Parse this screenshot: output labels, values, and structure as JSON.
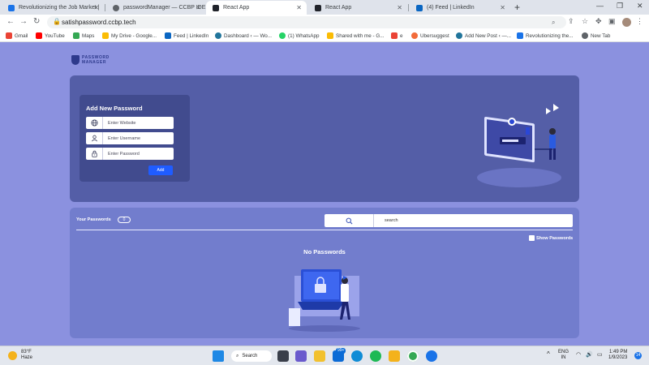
{
  "browser": {
    "tabs": [
      {
        "title": "Revolutionizing the Job Market |",
        "color": "#1a73e8"
      },
      {
        "title": "passwordManager — CCBP IDE",
        "color": "#5f6368"
      },
      {
        "title": "React App",
        "color": "#20232a"
      },
      {
        "title": "React App",
        "color": "#20232a"
      },
      {
        "title": "(4) Feed | LinkedIn",
        "color": "#0a66c2"
      }
    ],
    "url": "satishpassword.ccbp.tech",
    "bookmarks": [
      {
        "label": "Gmail",
        "color": "#ea4335"
      },
      {
        "label": "YouTube",
        "color": "#ff0000"
      },
      {
        "label": "Maps",
        "color": "#34a853"
      },
      {
        "label": "My Drive - Google...",
        "color": "#fbbc04"
      },
      {
        "label": "Feed | LinkedIn",
        "color": "#0a66c2"
      },
      {
        "label": "Dashboard ‹ — Wo...",
        "color": "#21759b"
      },
      {
        "label": "(1) WhatsApp",
        "color": "#25d366"
      },
      {
        "label": "Shared with me - G...",
        "color": "#fbbc04"
      },
      {
        "label": "e",
        "color": "#ea4335"
      },
      {
        "label": "Ubersuggest",
        "color": "#f26b3a"
      },
      {
        "label": "Add New Post ‹ —...",
        "color": "#21759b"
      },
      {
        "label": "Revolutionizing the...",
        "color": "#1a73e8"
      },
      {
        "label": "New Tab",
        "color": "#5f6368"
      }
    ]
  },
  "app": {
    "brand": {
      "line1": "PASSWORD",
      "line2": "MANAGER"
    },
    "form": {
      "title": "Add New Password",
      "website_placeholder": "Enter Website",
      "username_placeholder": "Enter Username",
      "password_placeholder": "Enter Password",
      "add_label": "Add"
    },
    "list": {
      "title": "Your Passwords",
      "count": "0",
      "search_placeholder": "search",
      "show_label": "Show Passwords",
      "empty_text": "No Passwords"
    },
    "colors": {
      "accent": "#1f5cff",
      "page_bg": "#8b91df",
      "top_panel": "#545ea7",
      "bottom_panel": "#727dcd",
      "form_card": "#414b8e"
    }
  },
  "taskbar": {
    "temp": "83°F",
    "condition": "Haze",
    "search_label": "Search",
    "mail_badge": "99+",
    "lang_line1": "ENG",
    "lang_line2": "IN",
    "time": "1:49 PM",
    "date": "1/9/2023",
    "notif_count": "14"
  }
}
